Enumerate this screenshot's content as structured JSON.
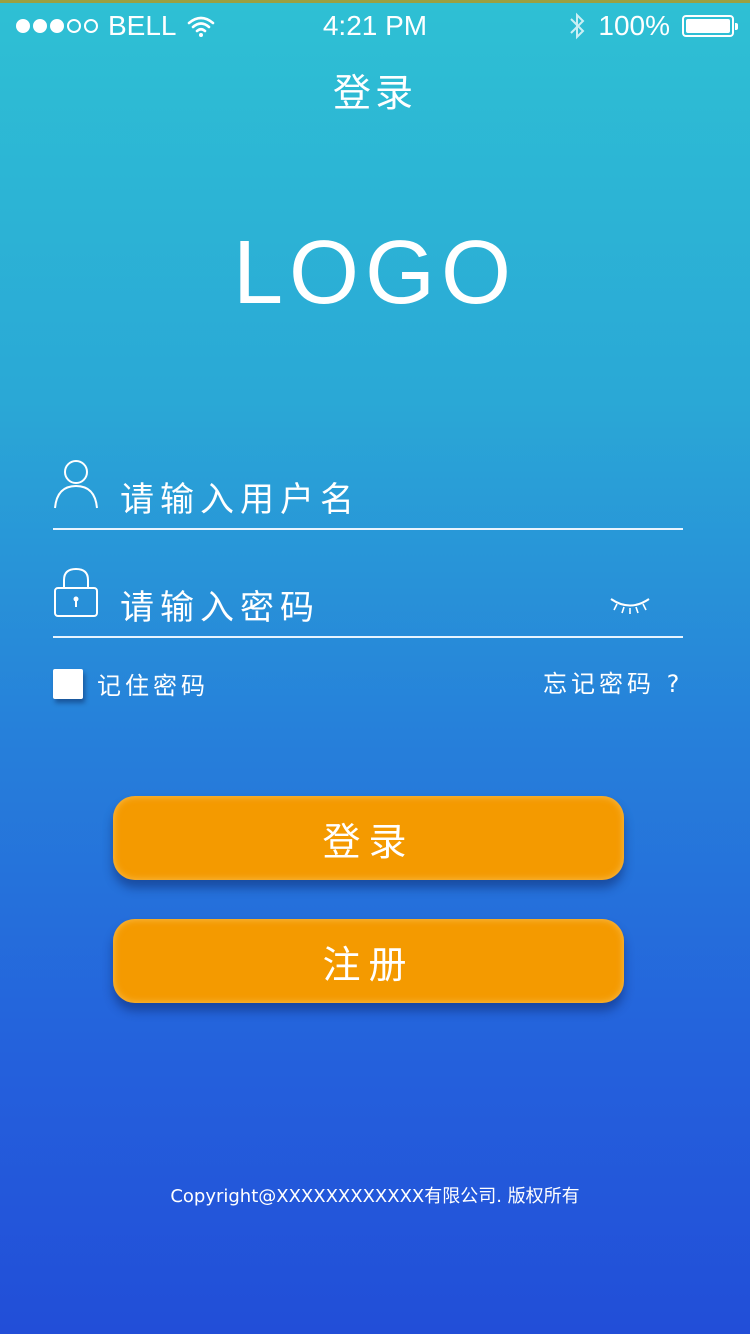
{
  "status_bar": {
    "signal_dots": [
      true,
      true,
      true,
      false,
      false
    ],
    "carrier": "BELL",
    "time": "4:21 PM",
    "battery": "100%"
  },
  "nav": {
    "title": "登录"
  },
  "logo": "LOGO",
  "form": {
    "username_placeholder": "请输入用户名",
    "password_placeholder": "请输入密码",
    "remember_label": "记住密码",
    "forgot_label": "忘记密码 ?"
  },
  "buttons": {
    "login": "登录",
    "register": "注册"
  },
  "footer": {
    "copyright": "Copyright@XXXXXXXXXXXX有限公司. 版权所有"
  },
  "colors": {
    "gradient_top": "#2ec0d4",
    "gradient_bottom": "#224ed8",
    "button": "#f49a00",
    "text": "#ffffff"
  },
  "icons": {
    "user": "person-outline-icon",
    "lock": "padlock-icon",
    "eye": "eye-closed-icon",
    "wifi": "wifi-icon",
    "bluetooth": "bluetooth-icon",
    "battery": "battery-icon"
  }
}
